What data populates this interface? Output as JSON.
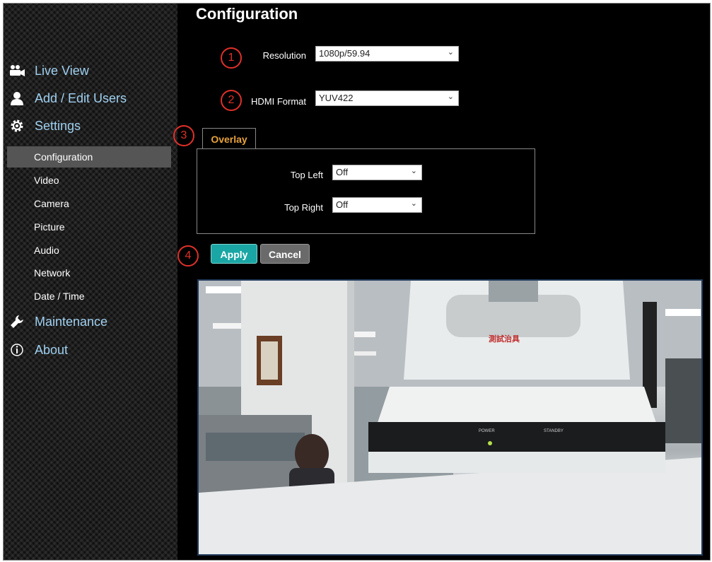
{
  "page": {
    "title": "Configuration"
  },
  "sidebar": {
    "main": [
      {
        "label": "Live View",
        "icon": "camera-icon"
      },
      {
        "label": "Add / Edit Users",
        "icon": "user-icon"
      },
      {
        "label": "Settings",
        "icon": "gear-icon"
      }
    ],
    "sub": [
      "Configuration",
      "Video",
      "Camera",
      "Picture",
      "Audio",
      "Network",
      "Date / Time"
    ],
    "active_sub": "Configuration",
    "bottom": [
      {
        "label": "Maintenance",
        "icon": "wrench-icon"
      },
      {
        "label": "About",
        "icon": "info-icon"
      }
    ]
  },
  "markers": [
    "1",
    "2",
    "3",
    "4"
  ],
  "form": {
    "resolution": {
      "label": "Resolution",
      "value": "1080p/59.94"
    },
    "hdmi_format": {
      "label": "HDMI Format",
      "value": "YUV422"
    },
    "overlay_tab": "Overlay",
    "top_left": {
      "label": "Top Left",
      "value": "Off"
    },
    "top_right": {
      "label": "Top Right",
      "value": "Off"
    }
  },
  "buttons": {
    "apply": "Apply",
    "cancel": "Cancel"
  },
  "camera_labels": {
    "tag": "測試治具",
    "power": "POWER",
    "standby": "STANDBY"
  },
  "colors": {
    "accent": "#1aa6a4",
    "tab_text": "#e8a33c",
    "marker": "#e0302a",
    "nav_link": "#9fd0f0"
  }
}
